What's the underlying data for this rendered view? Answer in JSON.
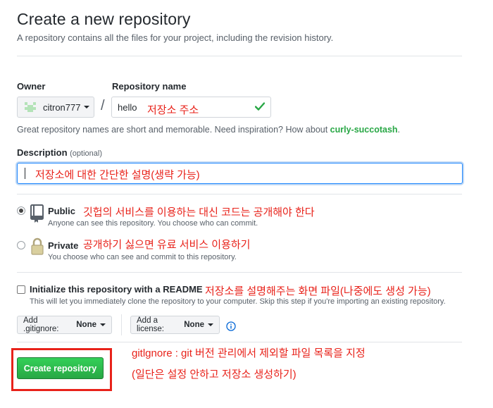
{
  "page": {
    "title": "Create a new repository",
    "subtitle": "A repository contains all the files for your project, including the revision history."
  },
  "owner": {
    "label": "Owner",
    "value": "citron777"
  },
  "repo": {
    "label": "Repository name",
    "value": "hello",
    "annotation": "저장소 주소"
  },
  "hint": {
    "text": "Great repository names are short and memorable. Need inspiration? How about ",
    "suggestion": "curly-succotash",
    "end": "."
  },
  "description": {
    "label": "Description",
    "optional": "(optional)",
    "annotation": "저장소에 대한 간단한 설명(생략 가능)"
  },
  "visibility": {
    "public": {
      "title": "Public",
      "desc": "Anyone can see this repository. You choose who can commit.",
      "annotation": "깃헙의 서비스를 이용하는 대신 코드는 공개해야 한다"
    },
    "private": {
      "title": "Private",
      "desc": "You choose who can see and commit to this repository.",
      "annotation": "공개하기 싫으면 유료 서비스 이용하기"
    }
  },
  "readme": {
    "title": "Initialize this repository with a README",
    "desc": "This will let you immediately clone the repository to your computer. Skip this step if you're importing an existing repository.",
    "annotation": "저장소를 설명해주는 화면 파일(나중에도 생성 가능)"
  },
  "gitignore": {
    "label": "Add .gitignore:",
    "value": "None"
  },
  "license": {
    "label": "Add a license:",
    "value": "None"
  },
  "create": {
    "button": "Create repository",
    "annotation_line1": "gitlgnore : git 버전 관리에서 제외할 파일 목록을 지정",
    "annotation_line2": "(일단은 설정 안하고 저장소 생성하기)"
  },
  "colors": {
    "annotation": "#e8221a",
    "primary_button": "#28a745",
    "focus_border": "#2188ff",
    "suggestion": "#28a745"
  },
  "icons": [
    "check-icon",
    "caret-down-icon",
    "repo-public-icon",
    "lock-icon",
    "info-icon",
    "identicon-avatar"
  ]
}
